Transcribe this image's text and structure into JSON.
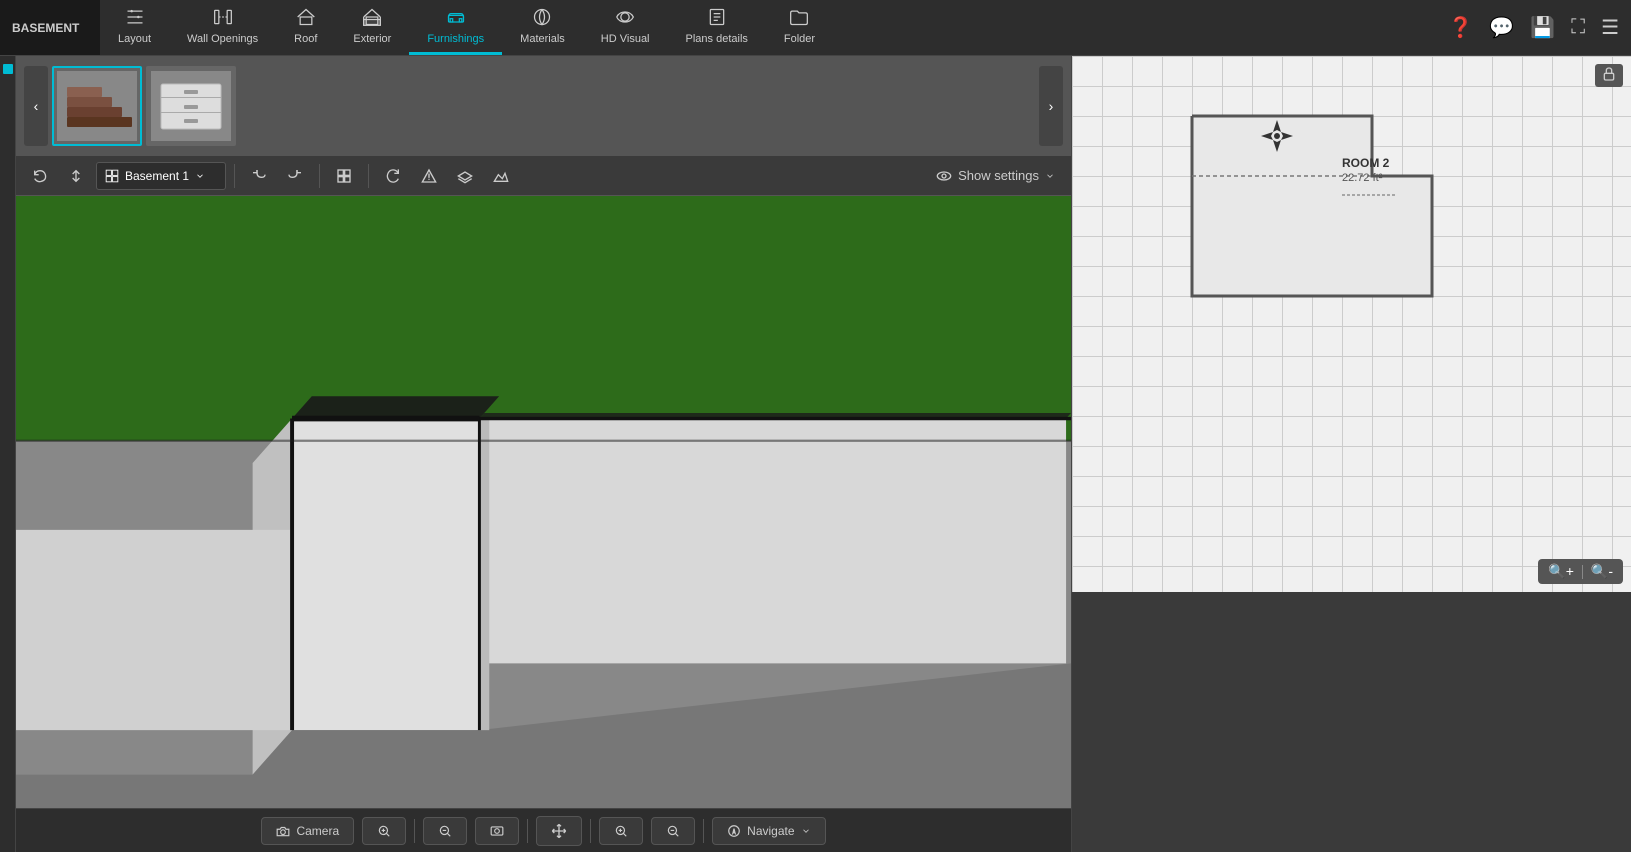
{
  "app": {
    "title": "BASEMENT",
    "active_tab": "Furnishings"
  },
  "nav": {
    "items": [
      {
        "id": "layout",
        "label": "Layout",
        "icon": "✏️",
        "active": false
      },
      {
        "id": "wall-openings",
        "label": "Wall Openings",
        "icon": "🚪",
        "active": false
      },
      {
        "id": "roof",
        "label": "Roof",
        "icon": "🏠",
        "active": false
      },
      {
        "id": "exterior",
        "label": "Exterior",
        "icon": "🏡",
        "active": false
      },
      {
        "id": "furnishings",
        "label": "Furnishings",
        "icon": "🛋️",
        "active": true
      },
      {
        "id": "materials",
        "label": "Materials",
        "icon": "🎨",
        "active": false
      },
      {
        "id": "hd-visual",
        "label": "HD Visual",
        "icon": "📷",
        "active": false
      },
      {
        "id": "plans-details",
        "label": "Plans details",
        "icon": "📋",
        "active": false
      },
      {
        "id": "folder",
        "label": "Folder",
        "icon": "📁",
        "active": false
      }
    ],
    "right_buttons": [
      "❓",
      "💬",
      "💾",
      "⛶"
    ]
  },
  "toolbar": {
    "floor_selector": {
      "icon": "▦",
      "label": "Basement 1",
      "has_dropdown": true
    },
    "show_settings": {
      "label": "Show settings",
      "icon": "👁"
    },
    "tools": [
      {
        "id": "refresh",
        "icon": "⟳"
      },
      {
        "id": "up-down",
        "icon": "⇅"
      },
      {
        "id": "floor-plan",
        "icon": "▦"
      },
      {
        "id": "undo",
        "icon": "↩"
      },
      {
        "id": "redo",
        "icon": "↪"
      },
      {
        "id": "camera",
        "icon": "⛶"
      },
      {
        "id": "rotate",
        "icon": "↻"
      },
      {
        "id": "warning",
        "icon": "⚠"
      },
      {
        "id": "layers",
        "icon": "⧉"
      },
      {
        "id": "mountain",
        "icon": "⛰"
      }
    ]
  },
  "thumbnails": [
    {
      "id": "thumb-1",
      "type": "stair",
      "selected": true
    },
    {
      "id": "thumb-2",
      "type": "drawer",
      "selected": false
    }
  ],
  "minimap": {
    "room_label": "ROOM 2",
    "room_area": "22.72 ft²"
  },
  "bottom_toolbar": {
    "buttons": [
      {
        "id": "camera",
        "label": "Camera",
        "icon": "🎥"
      },
      {
        "id": "zoom-in-cam",
        "icon": "🔍+",
        "label": ""
      },
      {
        "id": "zoom-out-cam",
        "icon": "🔍-",
        "label": ""
      },
      {
        "id": "screenshot",
        "icon": "📷",
        "label": ""
      },
      {
        "id": "move",
        "icon": "✛",
        "label": ""
      },
      {
        "id": "zoom-in",
        "icon": "🔎",
        "label": ""
      },
      {
        "id": "zoom-out",
        "icon": "🔎",
        "label": ""
      },
      {
        "id": "navigate",
        "label": "Navigate",
        "icon": "🧭"
      }
    ]
  }
}
